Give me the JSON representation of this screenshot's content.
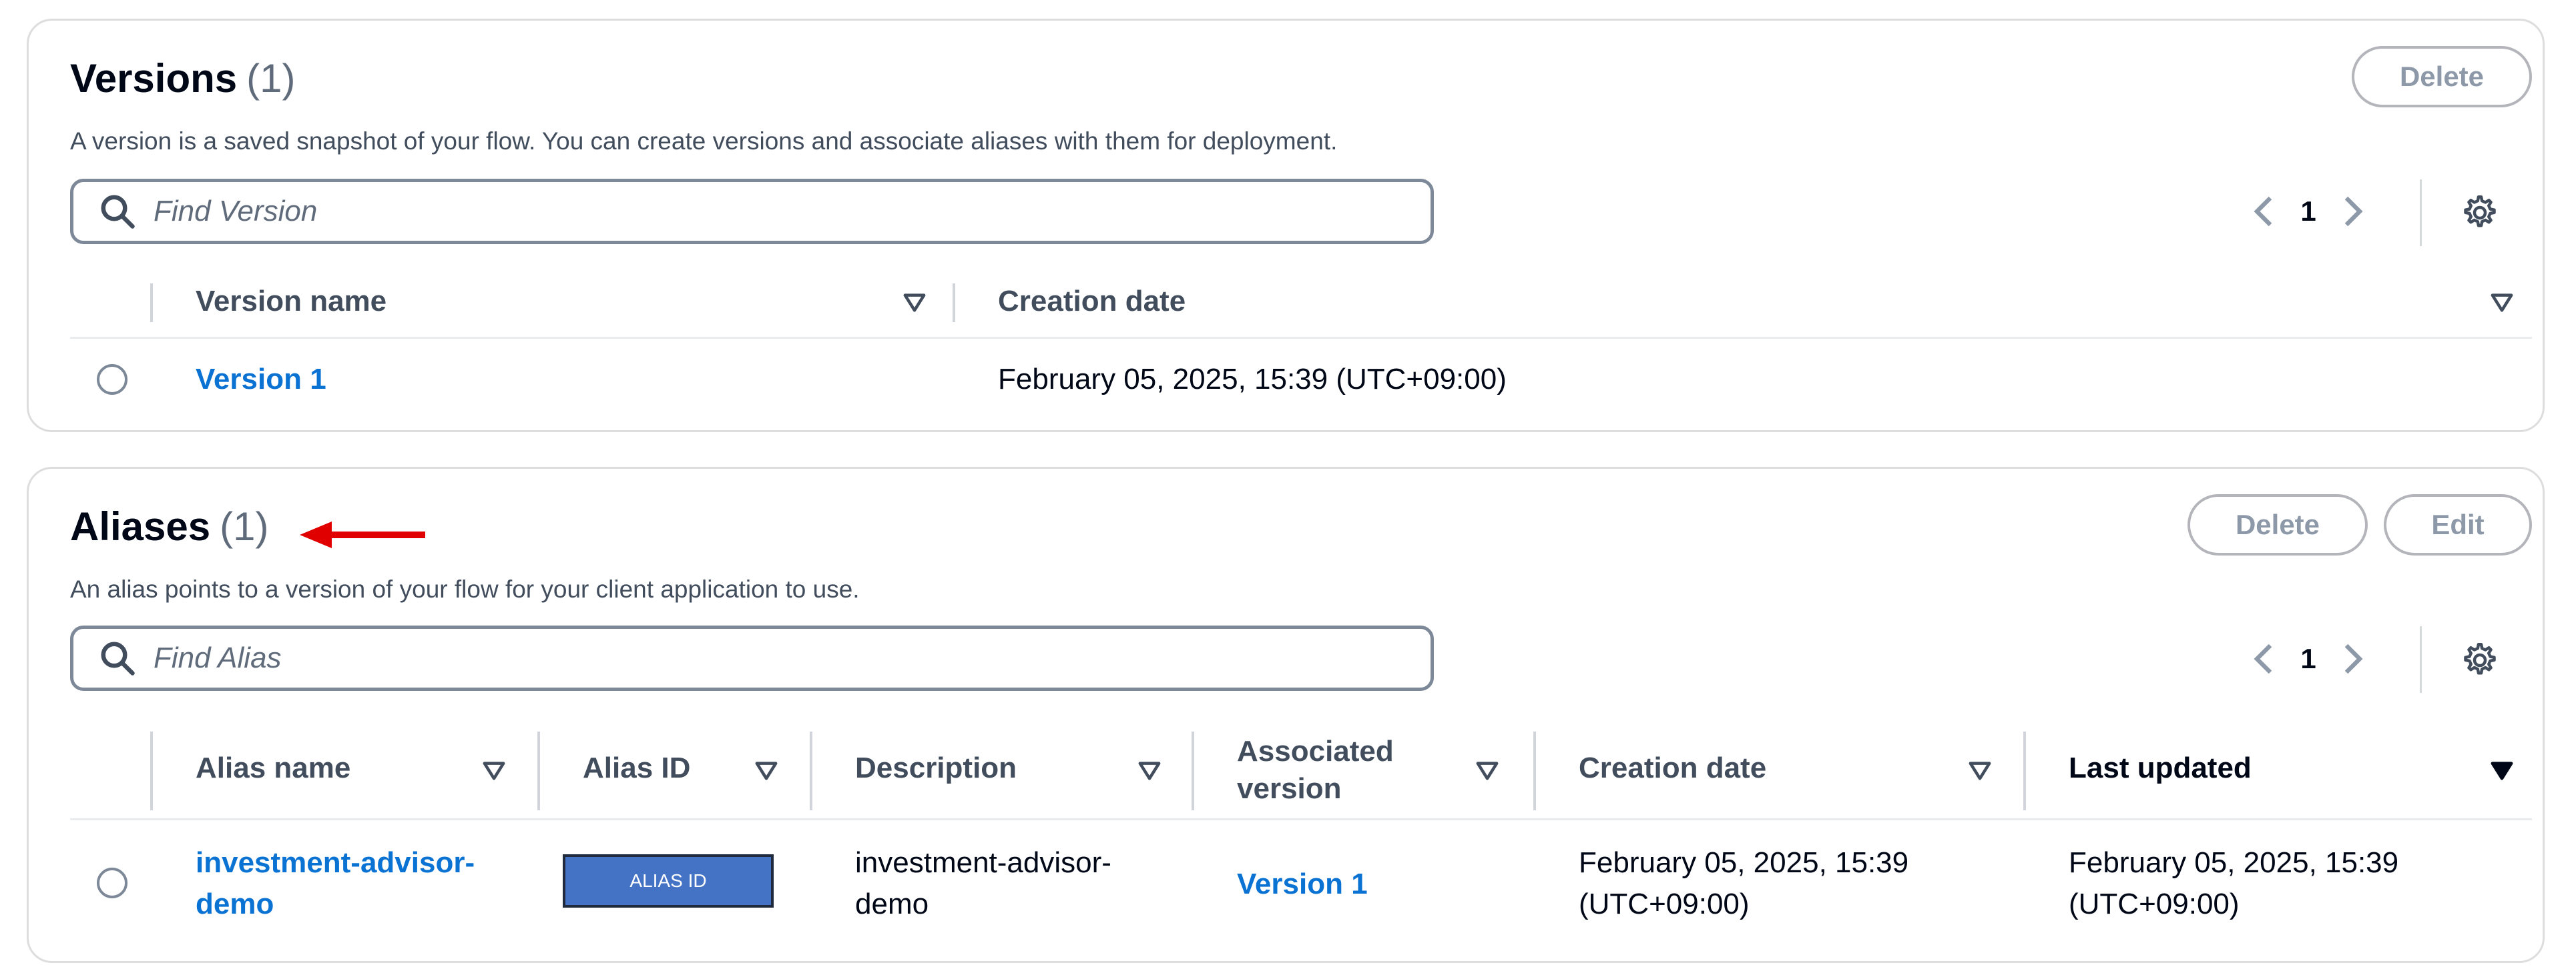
{
  "versions": {
    "title": "Versions",
    "count": "(1)",
    "description": "A version is a saved snapshot of your flow. You can create versions and associate aliases with them for deployment.",
    "delete_label": "Delete",
    "search_placeholder": "Find Version",
    "page_number": "1",
    "columns": [
      "Version name",
      "Creation date"
    ],
    "rows": [
      {
        "name": "Version 1",
        "creation_date": "February 05, 2025, 15:39 (UTC+09:00)"
      }
    ]
  },
  "aliases": {
    "title": "Aliases",
    "count": "(1)",
    "description": "An alias points to a version of your flow for your client application to use.",
    "delete_label": "Delete",
    "edit_label": "Edit",
    "search_placeholder": "Find Alias",
    "page_number": "1",
    "columns": {
      "alias_name": "Alias name",
      "alias_id": "Alias ID",
      "description": "Description",
      "associated_version_1": "Associated",
      "associated_version_2": "version",
      "creation_date": "Creation date",
      "last_updated": "Last updated"
    },
    "rows": [
      {
        "name_1": "investment-advisor-",
        "name_2": "demo",
        "alias_id": "ALIAS ID",
        "description_1": "investment-advisor-",
        "description_2": "demo",
        "version": "Version 1",
        "creation_1": "February 05, 2025, 15:39",
        "creation_2": "(UTC+09:00)",
        "updated_1": "February 05, 2025, 15:39",
        "updated_2": "(UTC+09:00)"
      }
    ]
  },
  "colors": {
    "link": "#0972d3",
    "alias_box": "#4472c4",
    "annotation_arrow": "#e00000"
  }
}
